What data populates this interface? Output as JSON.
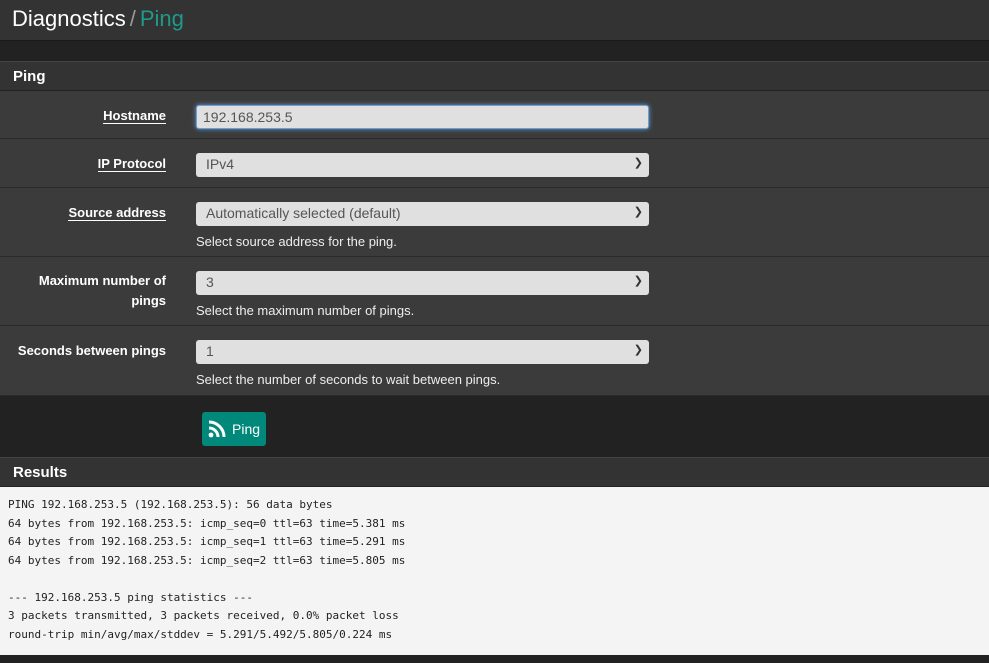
{
  "header": {
    "section": "Diagnostics",
    "separator": "/",
    "page": "Ping"
  },
  "panel": {
    "title": "Ping"
  },
  "form": {
    "hostname": {
      "label": "Hostname",
      "value": "192.168.253.5"
    },
    "ip_protocol": {
      "label": "IP Protocol",
      "value": "IPv4"
    },
    "source_address": {
      "label": "Source address",
      "value": "Automatically selected (default)",
      "help": "Select source address for the ping."
    },
    "max_pings": {
      "label": "Maximum number of pings",
      "value": "3",
      "help": "Select the maximum number of pings."
    },
    "seconds_between": {
      "label": "Seconds between pings",
      "value": "1",
      "help": "Select the number of seconds to wait between pings."
    }
  },
  "ping_button": {
    "label": "Ping",
    "icon": "rss-icon"
  },
  "results": {
    "title": "Results",
    "output": "PING 192.168.253.5 (192.168.253.5): 56 data bytes\n64 bytes from 192.168.253.5: icmp_seq=0 ttl=63 time=5.381 ms\n64 bytes from 192.168.253.5: icmp_seq=1 ttl=63 time=5.291 ms\n64 bytes from 192.168.253.5: icmp_seq=2 ttl=63 time=5.805 ms\n\n--- 192.168.253.5 ping statistics ---\n3 packets transmitted, 3 packets received, 0.0% packet loss\nround-trip min/avg/max/stddev = 5.291/5.492/5.805/0.224 ms"
  },
  "colors": {
    "accent": "#00897b"
  }
}
